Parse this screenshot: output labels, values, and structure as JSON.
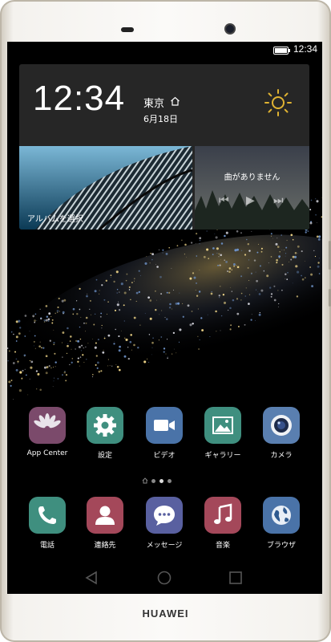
{
  "status": {
    "time": "12:34"
  },
  "widget": {
    "time": "12:34",
    "city": "東京",
    "date": "6月18日",
    "album_label": "アルバムを選択",
    "music_label": "曲がありません"
  },
  "apps": [
    {
      "label": "App Center",
      "icon": "huawei-logo-icon",
      "color": "#7b4a6b"
    },
    {
      "label": "設定",
      "icon": "gear-icon",
      "color": "#3f8f7f"
    },
    {
      "label": "ビデオ",
      "icon": "video-camera-icon",
      "color": "#4a73a8"
    },
    {
      "label": "ギャラリー",
      "icon": "picture-icon",
      "color": "#3f8f7f"
    },
    {
      "label": "カメラ",
      "icon": "camera-lens-icon",
      "color": "#5a7fb0"
    }
  ],
  "dock": [
    {
      "label": "電話",
      "icon": "phone-icon",
      "color": "#3f8f7f"
    },
    {
      "label": "連絡先",
      "icon": "contact-icon",
      "color": "#a4485a"
    },
    {
      "label": "メッセージ",
      "icon": "message-bubble-icon",
      "color": "#5960a0"
    },
    {
      "label": "音楽",
      "icon": "music-note-icon",
      "color": "#a4485a"
    },
    {
      "label": "ブラウザ",
      "icon": "globe-icon",
      "color": "#4a73a8"
    }
  ],
  "device": {
    "brand": "HUAWEI"
  }
}
